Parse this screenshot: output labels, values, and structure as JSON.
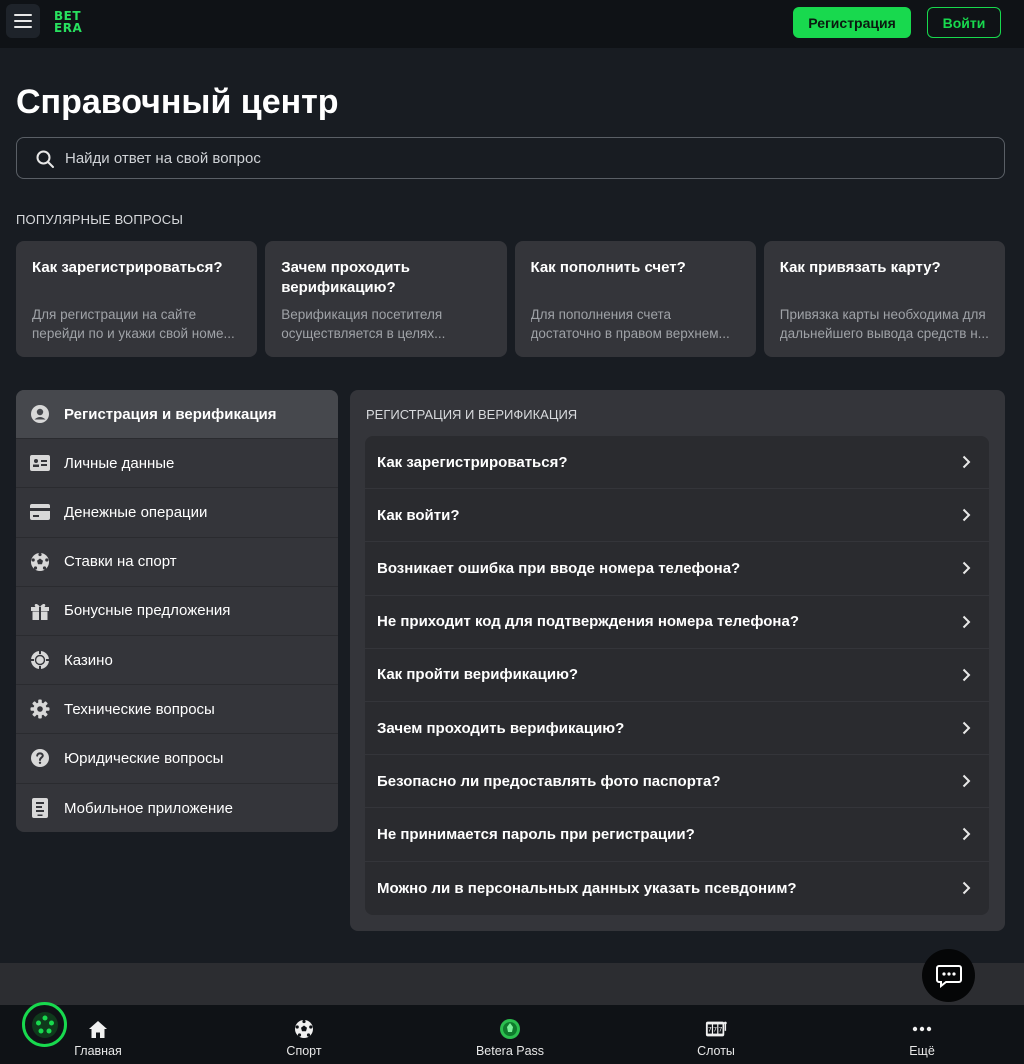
{
  "header": {
    "logo_line1": "BET",
    "logo_line2": "ERA",
    "register_label": "Регистрация",
    "login_label": "Войти"
  },
  "page": {
    "title": "Справочный центр"
  },
  "search": {
    "placeholder": "Найди ответ на свой вопрос"
  },
  "popular": {
    "label": "ПОПУЛЯРНЫЕ ВОПРОСЫ",
    "cards": [
      {
        "title": "Как зарегистрироваться?",
        "line1": "Для регистрации на сайте",
        "line2": "перейди по и укажи свой номе..."
      },
      {
        "title": "Зачем проходить верификацию?",
        "line1": "Верификация посетителя",
        "line2": "осуществляется в целях..."
      },
      {
        "title": "Как пополнить счет?",
        "line1": "Для пополнения счета",
        "line2": "достаточно в правом верхнем..."
      },
      {
        "title": "Как привязать карту?",
        "line1": "Привязка карты необходима для",
        "line2": "дальнейшего вывода средств н..."
      }
    ]
  },
  "categories": [
    {
      "label": "Регистрация и верификация",
      "icon": "user-circle-icon",
      "active": true
    },
    {
      "label": "Личные данные",
      "icon": "id-card-icon"
    },
    {
      "label": "Денежные операции",
      "icon": "credit-card-icon"
    },
    {
      "label": "Ставки на спорт",
      "icon": "soccer-ball-icon"
    },
    {
      "label": "Бонусные предложения",
      "icon": "gift-icon"
    },
    {
      "label": "Казино",
      "icon": "casino-chip-icon"
    },
    {
      "label": "Технические вопросы",
      "icon": "gear-icon"
    },
    {
      "label": "Юридические вопросы",
      "icon": "question-circle-icon"
    },
    {
      "label": "Мобильное приложение",
      "icon": "mobile-app-icon"
    }
  ],
  "questions": {
    "title": "РЕГИСТРАЦИЯ И ВЕРИФИКАЦИЯ",
    "items": [
      "Как зарегистрироваться?",
      "Как войти?",
      "Возникает ошибка при вводе номера телефона?",
      "Не приходит код для подтверждения номера телефона?",
      "Как пройти верификацию?",
      "Зачем проходить верификацию?",
      "Безопасно ли предоставлять фото паспорта?",
      "Не принимается пароль при регистрации?",
      "Можно ли в персональных данных указать псевдоним?"
    ]
  },
  "bottom_nav": [
    {
      "label": "Главная",
      "icon": "home-icon"
    },
    {
      "label": "Спорт",
      "icon": "soccer-ball-icon"
    },
    {
      "label": "Betera Pass",
      "icon": "betera-pass-icon"
    },
    {
      "label": "Слоты",
      "icon": "slots-icon"
    },
    {
      "label": "Ещё",
      "icon": "more-dots-icon"
    }
  ],
  "colors": {
    "accent": "#18d94e",
    "background": "#181c22",
    "card": "#34353a"
  }
}
